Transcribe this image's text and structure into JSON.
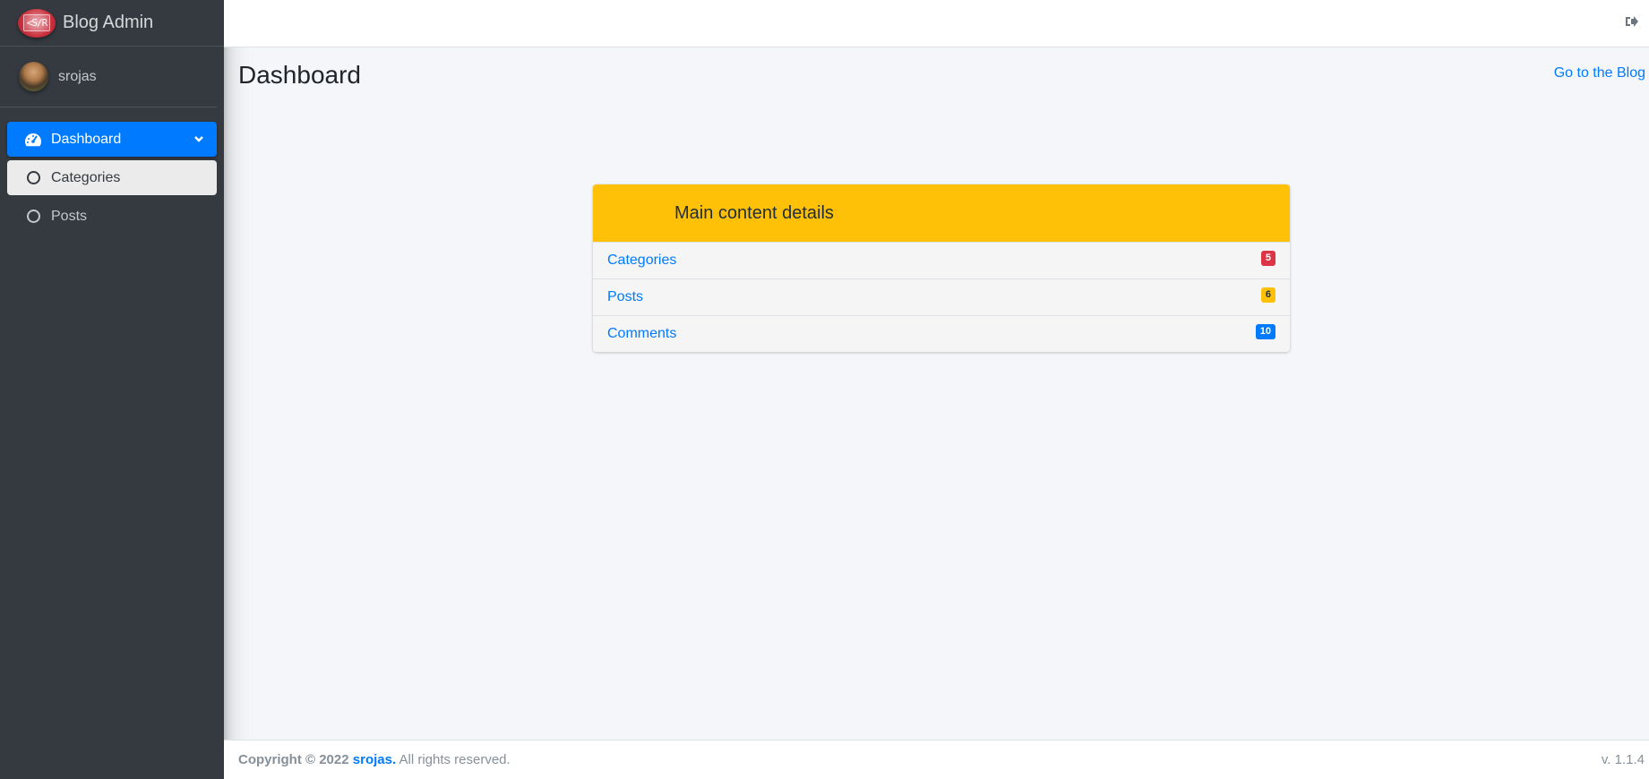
{
  "brand": {
    "title": "Blog Admin",
    "logo_text": "<S/R"
  },
  "user": {
    "name": "srojas"
  },
  "sidebar": {
    "items": [
      {
        "label": "Dashboard"
      },
      {
        "label": "Categories"
      },
      {
        "label": "Posts"
      }
    ]
  },
  "header": {
    "page_title": "Dashboard",
    "goto_blog": "Go to the Blog"
  },
  "card": {
    "title": "Main content details",
    "rows": [
      {
        "label": "Categories",
        "count": "5",
        "color": "#dc3545"
      },
      {
        "label": "Posts",
        "count": "6",
        "color": "#ffc107"
      },
      {
        "label": "Comments",
        "count": "10",
        "color": "#007bff"
      }
    ]
  },
  "footer": {
    "copyright": "Copyright © 2022",
    "owner": "srojas.",
    "rights": "All rights reserved.",
    "version": "v. 1.1.4"
  },
  "colors": {
    "accent": "#007bff",
    "card_header": "#ffc107",
    "sidebar": "#343a40"
  }
}
